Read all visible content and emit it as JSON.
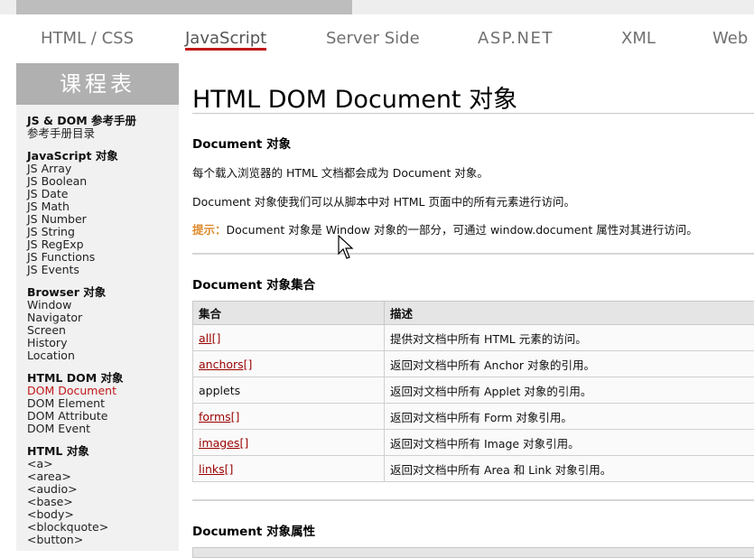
{
  "nav": {
    "tabs": [
      "HTML / CSS",
      "JavaScript",
      "Server Side",
      "ASP.NET",
      "XML",
      "Web"
    ],
    "active_tab": "JavaScript"
  },
  "sidebar": {
    "header": "课程表",
    "groups": [
      {
        "title": "JS & DOM 参考手册",
        "items": [
          "参考手册目录"
        ]
      },
      {
        "title": "JavaScript 对象",
        "items": [
          "JS Array",
          "JS Boolean",
          "JS Date",
          "JS Math",
          "JS Number",
          "JS String",
          "JS RegExp",
          "JS Functions",
          "JS Events"
        ]
      },
      {
        "title": "Browser 对象",
        "items": [
          "Window",
          "Navigator",
          "Screen",
          "History",
          "Location"
        ]
      },
      {
        "title": "HTML DOM 对象",
        "items": [
          "DOM Document",
          "DOM Element",
          "DOM Attribute",
          "DOM Event"
        ]
      },
      {
        "title": "HTML 对象",
        "items": [
          "<a>",
          "<area>",
          "<audio>",
          "<base>",
          "<body>",
          "<blockquote>",
          "<button>"
        ]
      }
    ],
    "active_item": "DOM Document"
  },
  "main": {
    "title": "HTML DOM Document 对象",
    "section1": {
      "heading": "Document 对象",
      "para1": "每个载入浏览器的 HTML 文档都会成为 Document 对象。",
      "para2": "Document 对象使我们可以从脚本中对 HTML 页面中的所有元素进行访问。",
      "tip_label": "提示：",
      "tip_text": "Document 对象是 Window 对象的一部分，可通过 window.document 属性对其进行访问。"
    },
    "section2": {
      "heading": "Document 对象集合",
      "columns": [
        "集合",
        "描述"
      ],
      "rows": [
        {
          "name": "all[]",
          "desc": "提供对文档中所有 HTML 元素的访问。",
          "link": true
        },
        {
          "name": "anchors[]",
          "desc": "返回对文档中所有 Anchor 对象的引用。",
          "link": true
        },
        {
          "name": "applets",
          "desc": "返回对文档中所有 Applet 对象的引用。",
          "link": false
        },
        {
          "name": "forms[]",
          "desc": "返回对文档中所有 Form 对象引用。",
          "link": true
        },
        {
          "name": "images[]",
          "desc": "返回对文档中所有 Image 对象引用。",
          "link": true
        },
        {
          "name": "links[]",
          "desc": "返回对文档中所有 Area 和 Link 对象引用。",
          "link": true
        }
      ]
    },
    "section3": {
      "heading": "Document 对象属性"
    }
  },
  "icons": {
    "cursor": "mouse-pointer-icon"
  },
  "colors": {
    "active_link": "#c01818",
    "table_link": "#990000",
    "tip": "#e08a2c",
    "sidebar_header_bg": "#b0b0b0",
    "sidebar_bg": "#f1f1f1"
  }
}
